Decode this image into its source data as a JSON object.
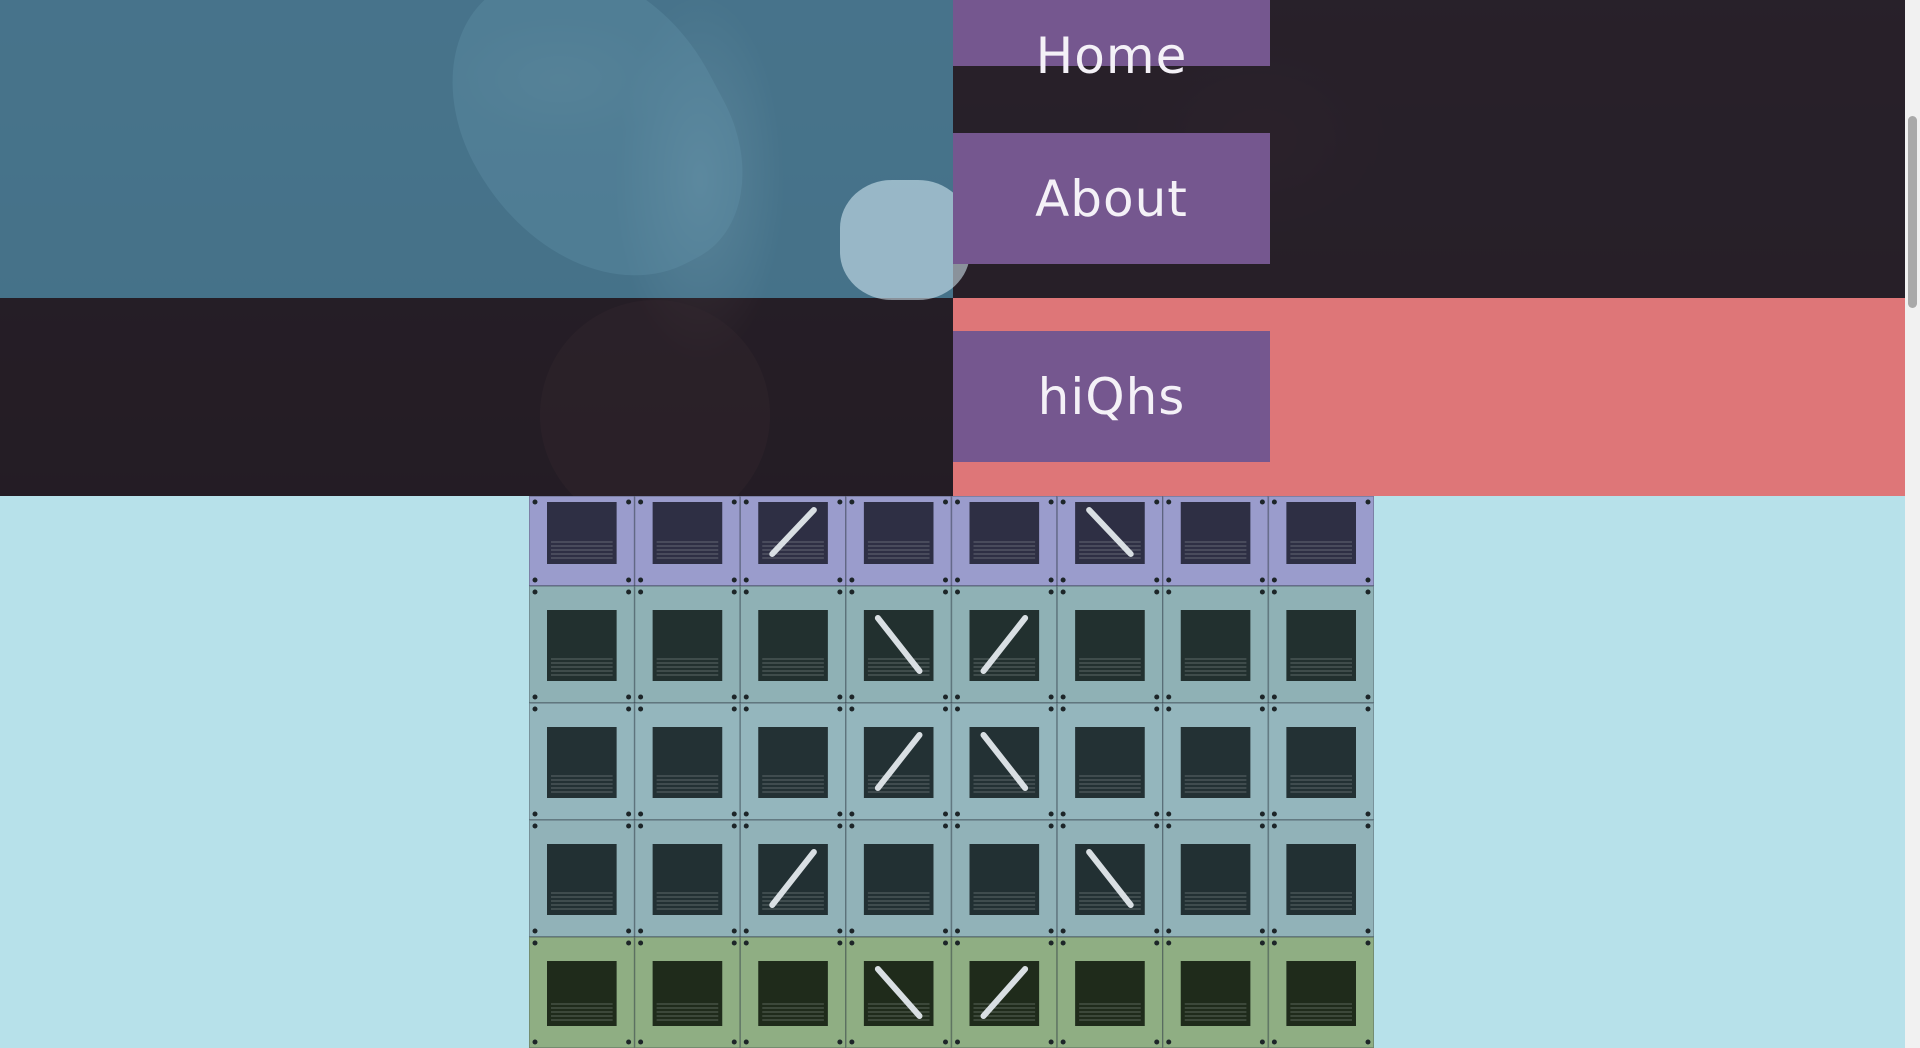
{
  "nav": {
    "items": [
      {
        "label": "Home"
      },
      {
        "label": "About"
      },
      {
        "label": "hiQhs"
      }
    ]
  },
  "icons": {
    "hero": "hero-photo",
    "grid": "building-facade-grid-photo"
  },
  "colors": {
    "nav_button": "#75578f",
    "coral": "#de7678",
    "sky": "#b7e1ea"
  }
}
